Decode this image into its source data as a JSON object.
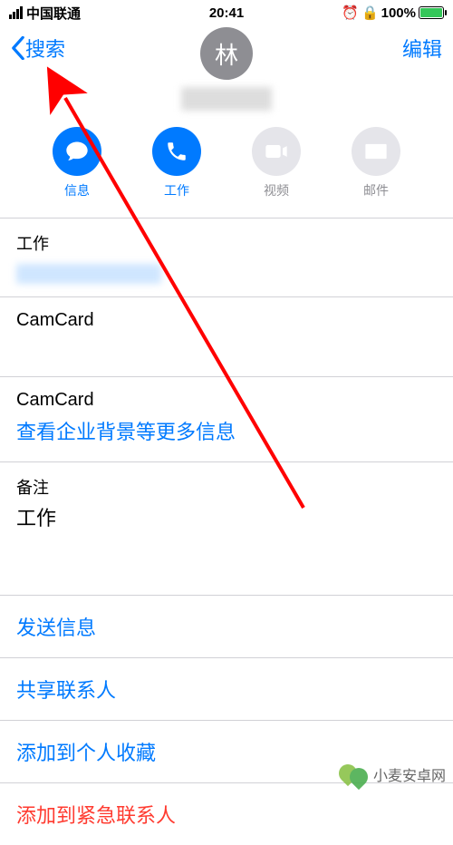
{
  "status": {
    "carrier": "中国联通",
    "time": "20:41",
    "battery_pct": "100%"
  },
  "nav": {
    "back_label": "搜索",
    "edit_label": "编辑"
  },
  "avatar_letter": "林",
  "actions": {
    "message": "信息",
    "work": "工作",
    "video": "视频",
    "mail": "邮件"
  },
  "sections": {
    "work_label": "工作",
    "camcard1": "CamCard",
    "camcard2": "CamCard",
    "camcard_link": "查看企业背景等更多信息",
    "notes_label": "备注",
    "notes_value": "工作"
  },
  "links": {
    "send_message": "发送信息",
    "share_contact": "共享联系人",
    "add_favorite": "添加到个人收藏",
    "add_emergency": "添加到紧急联系人"
  },
  "watermark": "小麦安卓网"
}
